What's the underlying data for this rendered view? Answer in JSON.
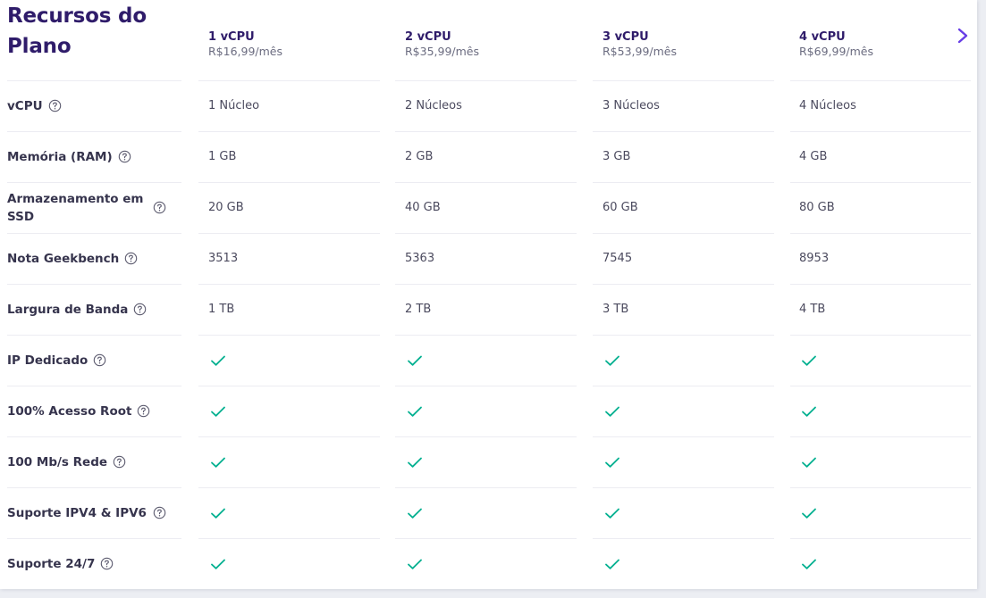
{
  "title": "Recursos do Plano",
  "plans": [
    {
      "name": "1 vCPU",
      "price": "R$16,99/mês"
    },
    {
      "name": "2 vCPU",
      "price": "R$35,99/mês"
    },
    {
      "name": "3 vCPU",
      "price": "R$53,99/mês"
    },
    {
      "name": "4 vCPU",
      "price": "R$69,99/mês"
    }
  ],
  "next_icon": "chevron-right-icon",
  "help_icon": "question-circle-icon",
  "check_icon": "check-icon",
  "colors": {
    "title": "#2f1c6a",
    "accent": "#673de6",
    "check": "#00b090",
    "label": "#36344d",
    "value": "#4b4a5e",
    "price": "#6b6c80",
    "divider": "#ececf2"
  },
  "features": [
    {
      "label": "vCPU",
      "values": [
        "1 Núcleo",
        "2 Núcleos",
        "3 Núcleos",
        "4 Núcleos"
      ]
    },
    {
      "label": "Memória (RAM)",
      "values": [
        "1 GB",
        "2 GB",
        "3 GB",
        "4 GB"
      ]
    },
    {
      "label": "Armazenamento em SSD",
      "values": [
        "20 GB",
        "40 GB",
        "60 GB",
        "80 GB"
      ]
    },
    {
      "label": "Nota Geekbench",
      "values": [
        "3513",
        "5363",
        "7545",
        "8953"
      ]
    },
    {
      "label": "Largura de Banda",
      "values": [
        "1 TB",
        "2 TB",
        "3 TB",
        "4 TB"
      ]
    },
    {
      "label": "IP Dedicado",
      "included": [
        true,
        true,
        true,
        true
      ]
    },
    {
      "label": "100% Acesso Root",
      "included": [
        true,
        true,
        true,
        true
      ]
    },
    {
      "label": "100 Mb/s Rede",
      "included": [
        true,
        true,
        true,
        true
      ]
    },
    {
      "label": "Suporte IPV4 & IPV6",
      "included": [
        true,
        true,
        true,
        true
      ]
    },
    {
      "label": "Suporte 24/7",
      "included": [
        true,
        true,
        true,
        true
      ]
    }
  ]
}
